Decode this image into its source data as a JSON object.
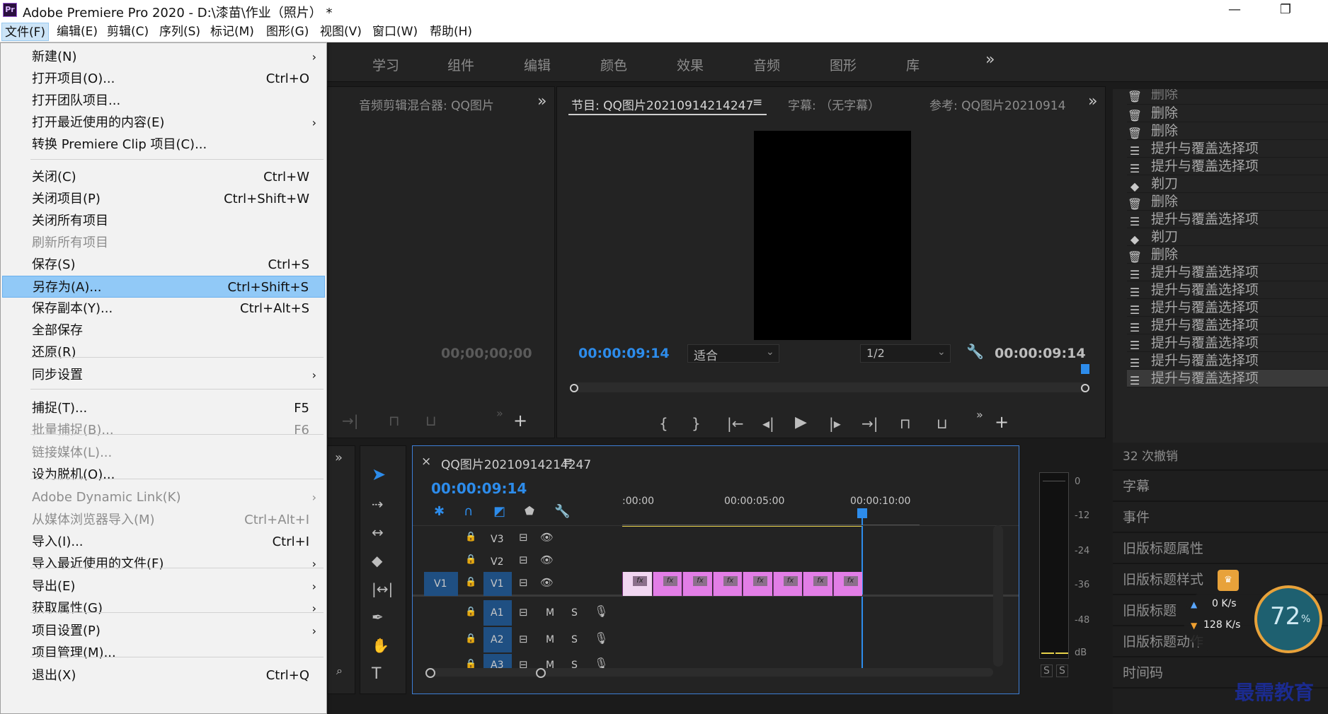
{
  "window": {
    "title": "Adobe Premiere Pro 2020 - D:\\漆苗\\作业（照片） *",
    "app_icon": "Pr",
    "minimize": "—",
    "restore": "❐"
  },
  "menubar": [
    "文件(F)",
    "编辑(E)",
    "剪辑(C)",
    "序列(S)",
    "标记(M)",
    "图形(G)",
    "视图(V)",
    "窗口(W)",
    "帮助(H)"
  ],
  "workspaces": [
    "学习",
    "组件",
    "编辑",
    "颜色",
    "效果",
    "音频",
    "图形",
    "库"
  ],
  "overflow": "»",
  "file_menu": [
    {
      "label": "新建(N)",
      "shortcut": "",
      "submenu": true,
      "disabled": false
    },
    {
      "label": "打开项目(O)...",
      "shortcut": "Ctrl+O",
      "submenu": false,
      "disabled": false
    },
    {
      "label": "打开团队项目...",
      "shortcut": "",
      "submenu": false,
      "disabled": false
    },
    {
      "label": "打开最近使用的内容(E)",
      "shortcut": "",
      "submenu": true,
      "disabled": false
    },
    {
      "label": "转换 Premiere Clip 项目(C)...",
      "shortcut": "",
      "submenu": false,
      "disabled": false
    },
    {
      "label": "关闭(C)",
      "shortcut": "Ctrl+W",
      "submenu": false,
      "disabled": false
    },
    {
      "label": "关闭项目(P)",
      "shortcut": "Ctrl+Shift+W",
      "submenu": false,
      "disabled": false
    },
    {
      "label": "关闭所有项目",
      "shortcut": "",
      "submenu": false,
      "disabled": false
    },
    {
      "label": "刷新所有项目",
      "shortcut": "",
      "submenu": false,
      "disabled": true
    },
    {
      "label": "保存(S)",
      "shortcut": "Ctrl+S",
      "submenu": false,
      "disabled": false
    },
    {
      "label": "另存为(A)...",
      "shortcut": "Ctrl+Shift+S",
      "submenu": false,
      "disabled": false,
      "highlighted": true
    },
    {
      "label": "保存副本(Y)...",
      "shortcut": "Ctrl+Alt+S",
      "submenu": false,
      "disabled": false
    },
    {
      "label": "全部保存",
      "shortcut": "",
      "submenu": false,
      "disabled": false
    },
    {
      "label": "还原(R)",
      "shortcut": "",
      "submenu": false,
      "disabled": false
    },
    {
      "label": "同步设置",
      "shortcut": "",
      "submenu": true,
      "disabled": false
    },
    {
      "label": "捕捉(T)...",
      "shortcut": "F5",
      "submenu": false,
      "disabled": false
    },
    {
      "label": "批量捕捉(B)...",
      "shortcut": "F6",
      "submenu": false,
      "disabled": true
    },
    {
      "label": "链接媒体(L)...",
      "shortcut": "",
      "submenu": false,
      "disabled": true
    },
    {
      "label": "设为脱机(O)...",
      "shortcut": "",
      "submenu": false,
      "disabled": false
    },
    {
      "label": "Adobe Dynamic Link(K)",
      "shortcut": "",
      "submenu": true,
      "disabled": true
    },
    {
      "label": "从媒体浏览器导入(M)",
      "shortcut": "Ctrl+Alt+I",
      "submenu": false,
      "disabled": true
    },
    {
      "label": "导入(I)...",
      "shortcut": "Ctrl+I",
      "submenu": false,
      "disabled": false
    },
    {
      "label": "导入最近使用的文件(F)",
      "shortcut": "",
      "submenu": true,
      "disabled": false
    },
    {
      "label": "导出(E)",
      "shortcut": "",
      "submenu": true,
      "disabled": false
    },
    {
      "label": "获取属性(G)",
      "shortcut": "",
      "submenu": true,
      "disabled": false
    },
    {
      "label": "项目设置(P)",
      "shortcut": "",
      "submenu": true,
      "disabled": false
    },
    {
      "label": "项目管理(M)...",
      "shortcut": "",
      "submenu": false,
      "disabled": false
    },
    {
      "label": "退出(X)",
      "shortcut": "Ctrl+Q",
      "submenu": false,
      "disabled": false
    }
  ],
  "audio_mixer": {
    "tab": "音频剪辑混合器: QQ图片",
    "timecode": "00;00;00;00"
  },
  "program": {
    "tab": "节目: QQ图片20210914214247",
    "menu_icon": "≡",
    "caption_tab": "字幕: （无字幕）",
    "reference_tab": "参考: QQ图片20210914",
    "timecode": "00:00:09:14",
    "fit": "适合",
    "resolution": "1/2",
    "duration": "00:00:09:14"
  },
  "history": {
    "partial_top": "删除",
    "items": [
      {
        "icon": "trash-icon",
        "label": "删除"
      },
      {
        "icon": "trash-icon",
        "label": "删除"
      },
      {
        "icon": "list-icon",
        "label": "提升与覆盖选择项"
      },
      {
        "icon": "list-icon",
        "label": "提升与覆盖选择项"
      },
      {
        "icon": "razor-icon",
        "label": "剃刀"
      },
      {
        "icon": "trash-icon",
        "label": "删除"
      },
      {
        "icon": "list-icon",
        "label": "提升与覆盖选择项"
      },
      {
        "icon": "razor-icon",
        "label": "剃刀"
      },
      {
        "icon": "trash-icon",
        "label": "删除"
      },
      {
        "icon": "list-icon",
        "label": "提升与覆盖选择项"
      },
      {
        "icon": "list-icon",
        "label": "提升与覆盖选择项"
      },
      {
        "icon": "list-icon",
        "label": "提升与覆盖选择项"
      },
      {
        "icon": "list-icon",
        "label": "提升与覆盖选择项"
      },
      {
        "icon": "list-icon",
        "label": "提升与覆盖选择项"
      },
      {
        "icon": "list-icon",
        "label": "提升与覆盖选择项"
      },
      {
        "icon": "list-icon",
        "label": "提升与覆盖选择项"
      }
    ],
    "undo_count": "32 次撤销"
  },
  "side_panels": [
    "字幕",
    "事件",
    "旧版标题属性",
    "旧版标题样式",
    "旧版标题",
    "旧版标题动作",
    "时间码"
  ],
  "timeline": {
    "tab": "QQ图片20210914214247",
    "close": "×",
    "menu_icon": "≡",
    "timecode": "00:00:09:14",
    "ruler": [
      ":00:00",
      "00:00:05:00",
      "00:00:10:00"
    ],
    "video_tracks": [
      "V3",
      "V2",
      "V1"
    ],
    "audio_tracks": [
      "A1",
      "A2",
      "A3"
    ],
    "source_patch": "V1",
    "m": "M",
    "s": "S",
    "fx_label": "fx",
    "clip_count": 8
  },
  "meter": {
    "scale": [
      "0",
      "-12",
      "-24",
      "-36",
      "-48",
      "dB"
    ],
    "solo": [
      "S",
      "S"
    ]
  },
  "speed_widget": {
    "up": "0 K/s",
    "down": "128 K/s",
    "percent": "72",
    "unit": "%"
  },
  "watermark": "最需教育",
  "colors": {
    "accent_blue": "#2d8ceb",
    "clip_pink": "#e27ee6",
    "menu_highlight": "#91c9f7"
  }
}
